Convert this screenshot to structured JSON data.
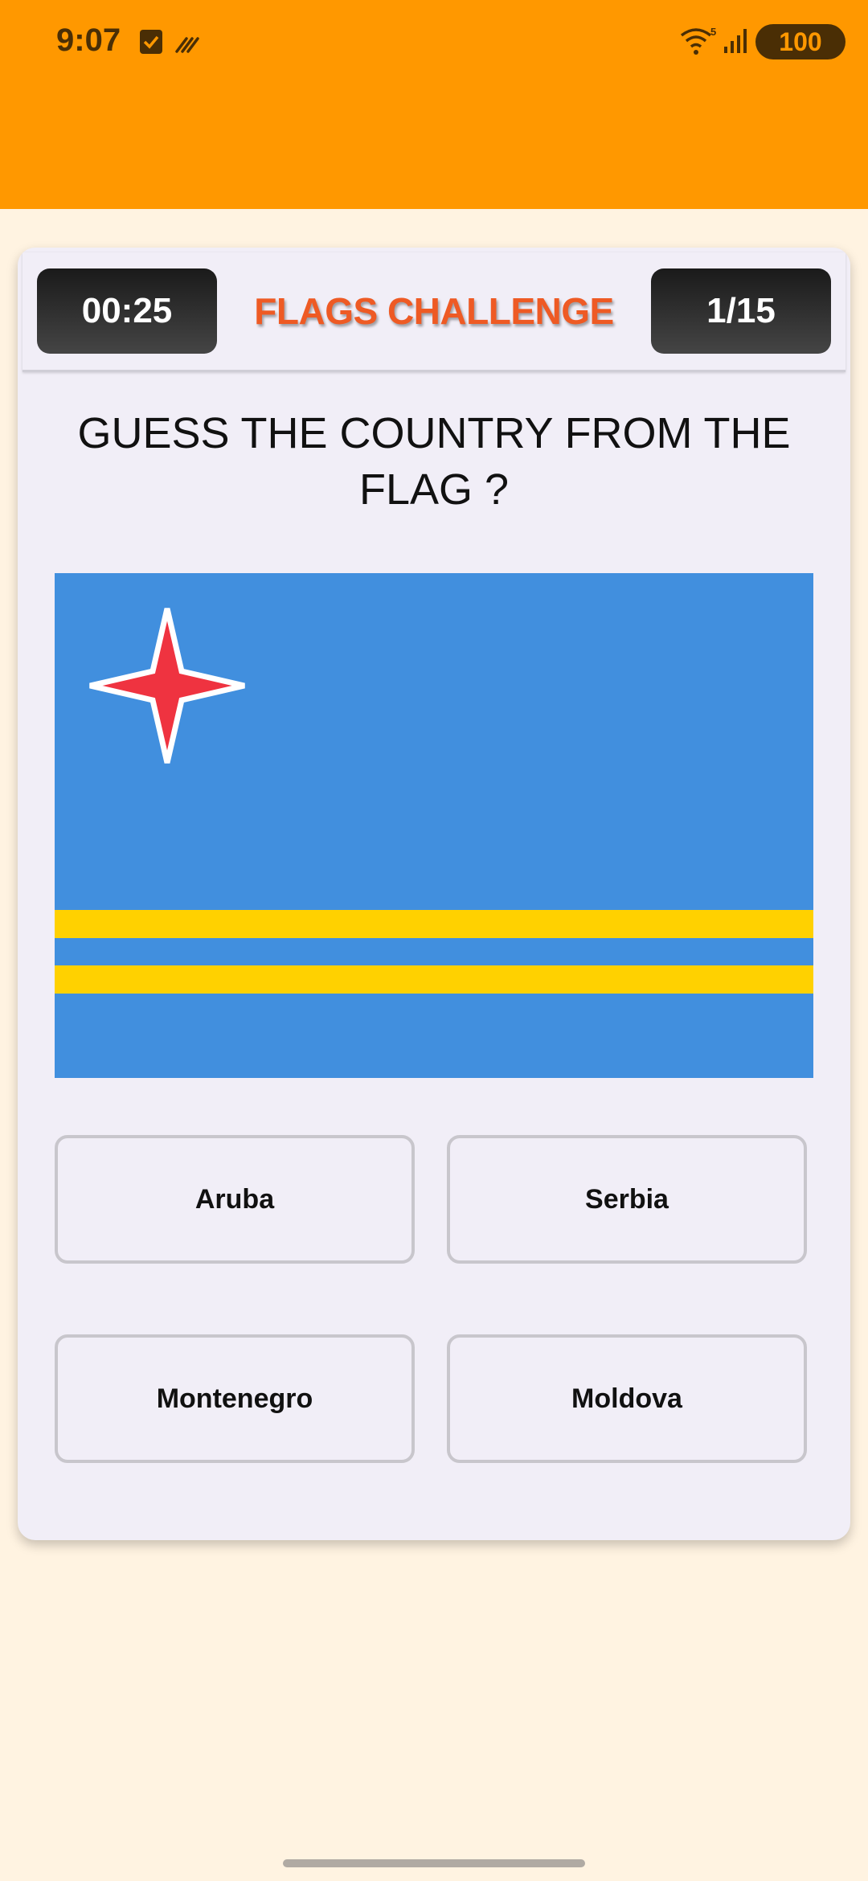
{
  "status_bar": {
    "time": "9:07",
    "battery": "100",
    "icons": [
      "checkbox-icon",
      "stripes-icon",
      "wifi-icon",
      "signal-icon"
    ],
    "color": "#ff9800"
  },
  "header": {
    "timer": "00:25",
    "title": "FLAGS CHALLENGE",
    "progress": "1/15",
    "title_color": "#ee5a24"
  },
  "question": "GUESS THE COUNTRY FROM THE FLAG ?",
  "flag": {
    "icon": "aruba-flag",
    "colors": {
      "field": "#418fde",
      "stripes": "#ffd100",
      "star": "#ef3340",
      "star_border": "#ffffff"
    }
  },
  "options": [
    "Aruba",
    "Serbia",
    "Montenegro",
    "Moldova"
  ]
}
